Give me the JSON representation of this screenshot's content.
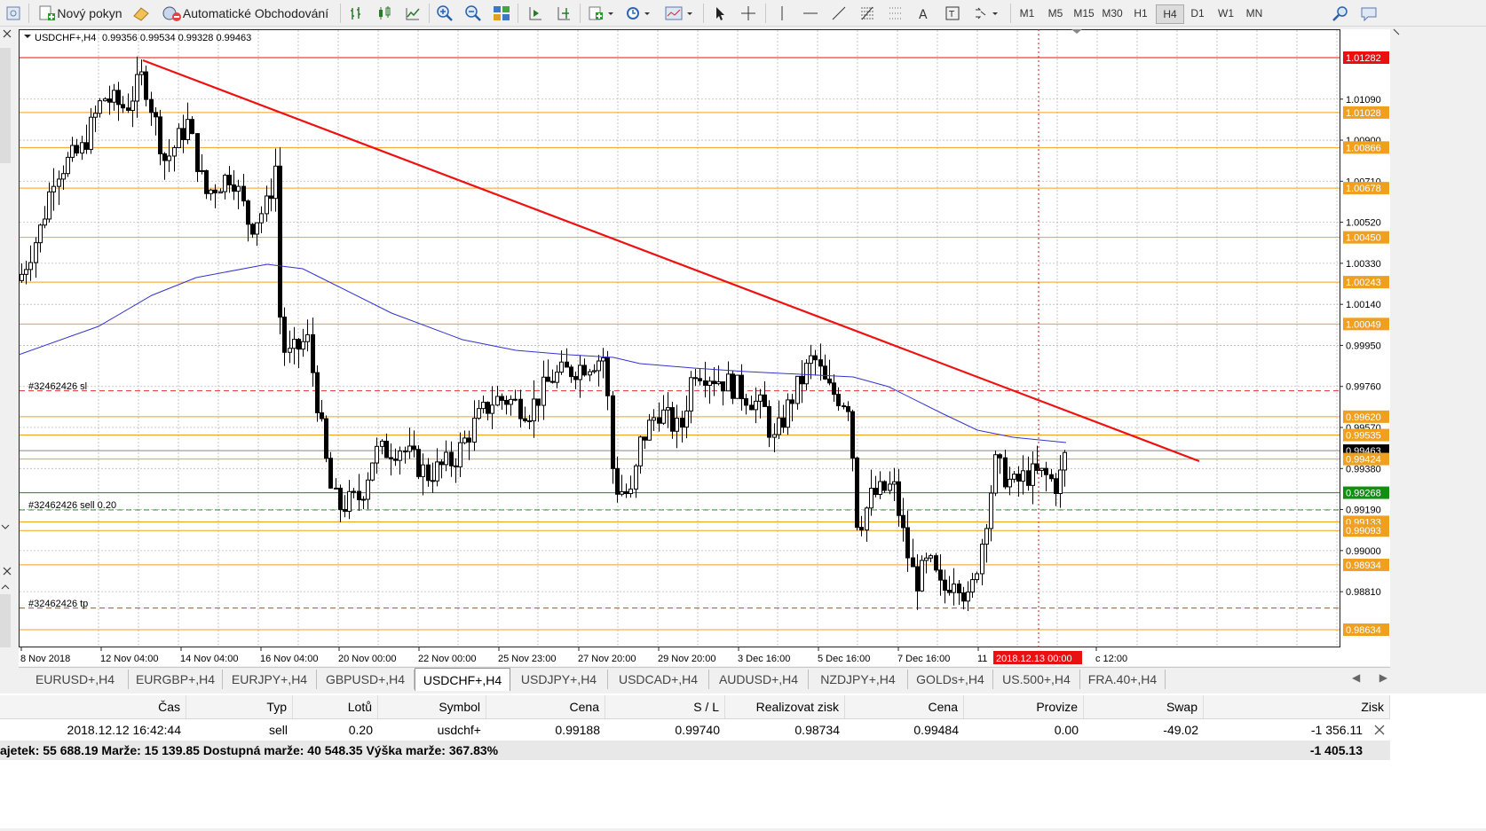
{
  "toolbar": {
    "new_order_label": "Nový pokyn",
    "auto_trading_label": "Automatické Obchodování",
    "timeframes": [
      "M1",
      "M5",
      "M15",
      "M30",
      "H1",
      "H4",
      "D1",
      "W1",
      "MN"
    ],
    "active_timeframe": "H4"
  },
  "chart": {
    "symbol_info": "USDCHF+,H4",
    "ohlc": "0.99356 0.99534 0.99328 0.99463",
    "line_color_trend": "#ee1111",
    "line_color_ma": "#3333cc",
    "level_color": "#f0a020",
    "order_labels": {
      "sl": "#32462426 sl",
      "sell": "#32462426 sell 0.20",
      "tp": "#32462426 tp"
    },
    "price_scale": [
      "1.01090",
      "1.00900",
      "1.00710",
      "1.00520",
      "1.00330",
      "1.00140",
      "0.99950",
      "0.99760",
      "0.99570",
      "0.99380",
      "0.99190",
      "0.99000",
      "0.98810"
    ],
    "price_tags": [
      {
        "label": "1.01282",
        "color": "#e81010"
      },
      {
        "label": "1.01028",
        "color": "#f0a020"
      },
      {
        "label": "1.00866",
        "color": "#f0a020"
      },
      {
        "label": "1.00678",
        "color": "#f0a020"
      },
      {
        "label": "1.00450",
        "color": "#f0a020"
      },
      {
        "label": "1.00243",
        "color": "#f0a020"
      },
      {
        "label": "1.00049",
        "color": "#f0a020"
      },
      {
        "label": "0.99620",
        "color": "#f0a020"
      },
      {
        "label": "0.99535",
        "color": "#f0a020"
      },
      {
        "label": "0.99463",
        "color": "#000000"
      },
      {
        "label": "0.99424",
        "color": "#f0a020"
      },
      {
        "label": "0.99268",
        "color": "#109010"
      },
      {
        "label": "0.99133",
        "color": "#f0a020"
      },
      {
        "label": "0.99093",
        "color": "#f0a020"
      },
      {
        "label": "0.98934",
        "color": "#f0a020"
      },
      {
        "label": "0.98634",
        "color": "#f0a020"
      }
    ],
    "time_labels": [
      "8 Nov 2018",
      "12 Nov 04:00",
      "14 Nov 04:00",
      "16 Nov 04:00",
      "20 Nov 00:00",
      "22 Nov 00:00",
      "25 Nov 23:00",
      "27 Nov 20:00",
      "29 Nov 20:00",
      "3 Dec 16:00",
      "5 Dec 16:00",
      "7 Dec 16:00",
      "11",
      "c 12:00"
    ],
    "cursor_time": "2018.12.13 00:00"
  },
  "tabs": [
    "EURUSD+,H4",
    "EURGBP+,H4",
    "EURJPY+,H4",
    "GBPUSD+,H4",
    "USDCHF+,H4",
    "USDJPY+,H4",
    "USDCAD+,H4",
    "AUDUSD+,H4",
    "NZDJPY+,H4",
    "GOLDs+,H4",
    "US.500+,H4",
    "FRA.40+,H4"
  ],
  "active_tab": "USDCHF+,H4",
  "terminal": {
    "headers": {
      "time": "Čas",
      "type": "Typ",
      "lots": "Lotů",
      "symbol": "Symbol",
      "price": "Cena",
      "sl": "S / L",
      "tp": "Realizovat zisk",
      "cur_price": "Cena",
      "commission": "Provize",
      "swap": "Swap",
      "profit": "Zisk"
    },
    "order": {
      "time": "2018.12.12 16:42:44",
      "type": "sell",
      "lots": "0.20",
      "symbol": "usdchf+",
      "price": "0.99188",
      "sl": "0.99740",
      "tp": "0.98734",
      "cur_price": "0.99484",
      "commission": "0.00",
      "swap": "-49.02",
      "profit": "-1 356.11"
    },
    "summary": "ajetek: 55 688.19  Marže: 15 139.85  Dostupná marže: 40 548.35  Výška marže: 367.83%",
    "total": "-1 405.13"
  }
}
